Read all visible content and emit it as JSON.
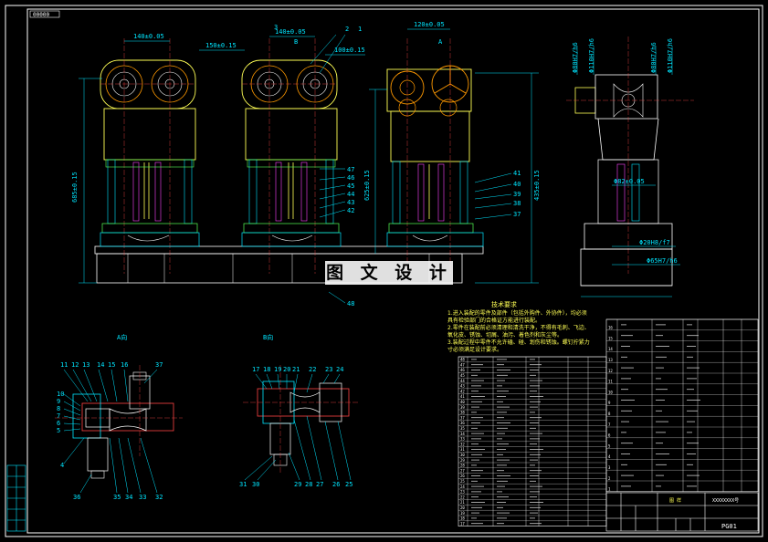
{
  "sheet": {
    "tag": "00000",
    "drawing_no": "PG01",
    "title_block_label": "图 样",
    "company_code": "XXXXXXXX号",
    "watermark": "图 文 设 计"
  },
  "front_view": {
    "dims_top": [
      "140±0.05",
      "150±0.15",
      "140±0.05",
      "100±0.15",
      "120±0.05"
    ],
    "dims_vertical": [
      "685±0.15",
      "625±0.15",
      "435±0.15"
    ],
    "view_markers": [
      "B",
      "A"
    ],
    "part_callouts_top": [
      "2",
      "1",
      "3"
    ],
    "part_callouts_side_mid": [
      "47",
      "46",
      "45",
      "44",
      "43",
      "42"
    ],
    "part_callouts_side_right": [
      "41",
      "40",
      "39",
      "38",
      "37"
    ],
    "part_callout_bottom": "48"
  },
  "side_view": {
    "dim_labels": [
      "Φ80H7/h6",
      "Φ110H7/h6",
      "Φ80H7/h6",
      "Φ110H7/h6",
      "Φ82±0.05",
      "Φ20H8/f7",
      "Φ65H7/h6"
    ]
  },
  "section_a": {
    "title": "A向",
    "callouts_top": [
      "11",
      "12",
      "13",
      "14",
      "15",
      "16",
      "37"
    ],
    "callouts_left": [
      "10",
      "9",
      "8",
      "7",
      "6",
      "5",
      "4"
    ],
    "callouts_bottom": [
      "36",
      "35",
      "34",
      "33",
      "32"
    ]
  },
  "section_b": {
    "title": "B向",
    "callouts_top": [
      "17",
      "18",
      "19",
      "20",
      "21",
      "22",
      "23",
      "24"
    ],
    "callouts_bottom": [
      "31",
      "30",
      "29",
      "28",
      "27",
      "26",
      "25"
    ]
  },
  "tech_req": {
    "title": "技术要求",
    "lines": [
      "1.进入装配的零件及部件（包括外购件、外协件），均必须",
      "具有检验部门的合格证方能进行装配。",
      "2.零件在装配前必须清理和清洗干净，不得有毛刺、飞边、",
      "氧化皮、锈蚀、切屑、油污、着色剂和灰尘等。",
      "3.装配过程中零件不允许磕、碰、划伤和锈蚀。螺钉拧紧力",
      "寸必须满足设计要求。"
    ]
  },
  "bom": {
    "rows_left": [
      "48",
      "47",
      "46",
      "45",
      "44",
      "43",
      "42",
      "41",
      "40",
      "39",
      "38",
      "37",
      "36",
      "35",
      "34",
      "33",
      "32",
      "31",
      "30",
      "29",
      "28",
      "27",
      "26",
      "25",
      "24",
      "23",
      "22",
      "21",
      "20",
      "19",
      "18",
      "17"
    ],
    "rows_right": [
      "16",
      "15",
      "14",
      "13",
      "12",
      "11",
      "10",
      "9",
      "8",
      "7",
      "6",
      "5",
      "4",
      "3",
      "2",
      "1"
    ]
  },
  "colors": {
    "outline": "#ffffff",
    "dimension": "#00e5ff",
    "center": "#ff4444",
    "body": "#ffff55",
    "green": "#55ff55",
    "orange": "#ff9900",
    "magenta": "#ff44ff"
  }
}
